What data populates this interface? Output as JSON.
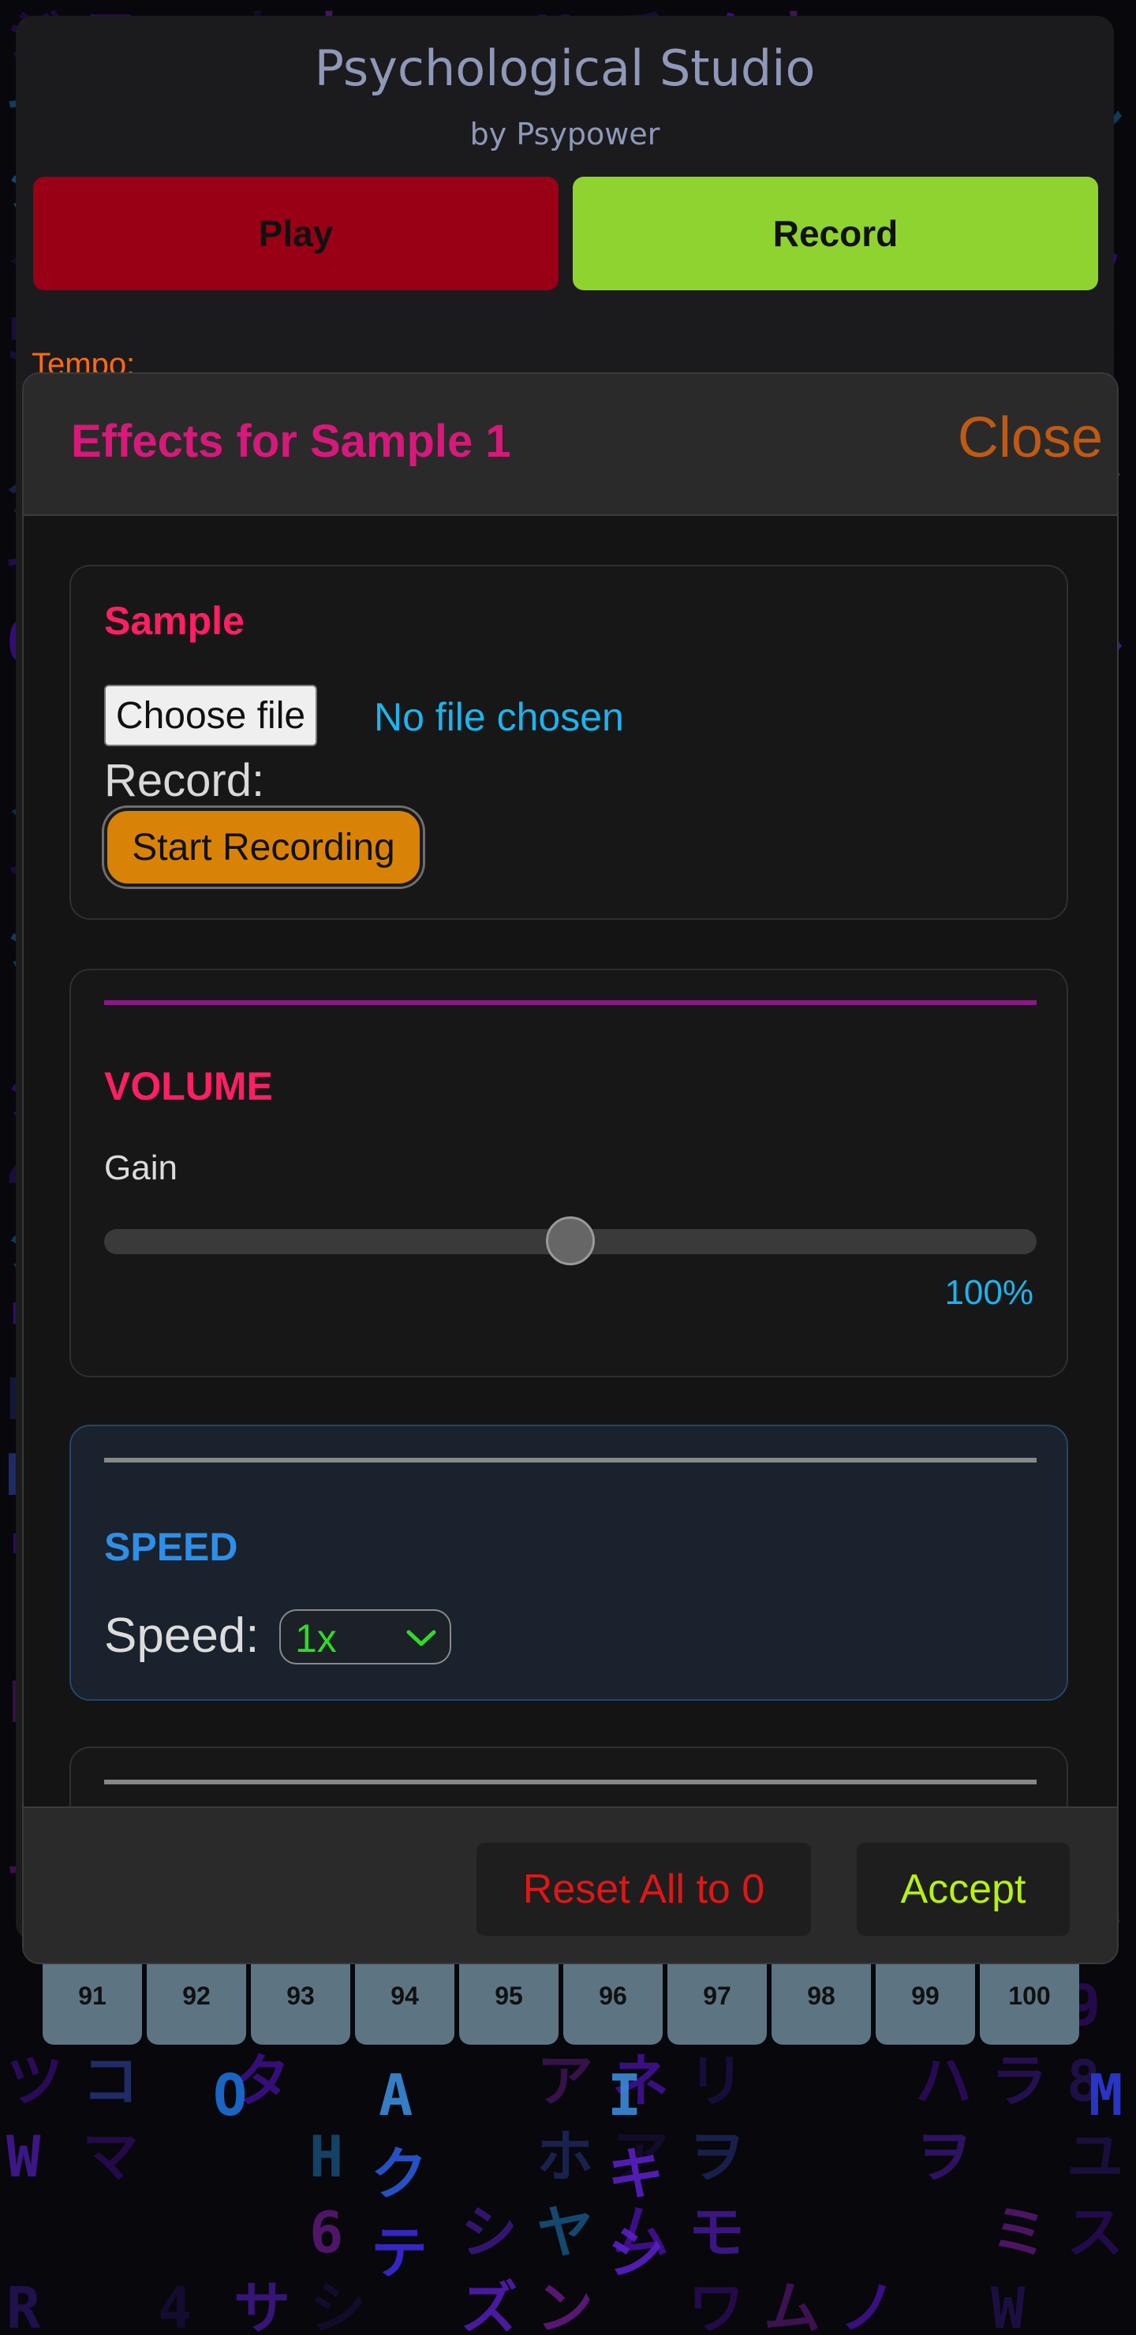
{
  "app": {
    "title": "Psychological Studio",
    "subtitle": "by Psypower",
    "play_label": "Play",
    "record_label": "Record",
    "tempo_label": "Tempo:"
  },
  "pads": [
    "91",
    "92",
    "93",
    "94",
    "95",
    "96",
    "97",
    "98",
    "99",
    "100"
  ],
  "modal": {
    "title": "Effects for Sample 1",
    "close_label": "Close",
    "sample": {
      "title": "Sample",
      "choose_file_label": "Choose file",
      "file_status": "No file chosen",
      "record_label": "Record:",
      "start_recording_label": "Start Recording"
    },
    "volume": {
      "title": "VOLUME",
      "gain_label": "Gain",
      "gain_value": "100%",
      "gain_level": 0.5
    },
    "speed": {
      "title": "SPEED",
      "speed_label": "Speed:",
      "speed_value": "1x"
    },
    "footer": {
      "reset_label": "Reset All to 0",
      "accept_label": "Accept"
    }
  },
  "background": {
    "style": "matrix-katakana-rain",
    "glyphs": "アイウエオカキクケコサシスセソタチツテトナニヌネノハヒフヘホマミムメモヤユヨラリルレロワヲンゲゼグジズダ0123456789ABCDEFGHIJKLMNOPQRSTUVWXYZ",
    "colors": [
      "#3a0d7a",
      "#4b12a8",
      "#5a1fc4",
      "#23104f",
      "#7a1f9e",
      "#2b1466",
      "#1a5a8a",
      "#2a3a8a"
    ],
    "highlight_glyphs": [
      "O",
      "A",
      "I",
      "M",
      "ク",
      "テ",
      "シ",
      "キ"
    ]
  },
  "colors": {
    "play": "#990016",
    "record": "#8fd330",
    "modal_title": "#d6197a",
    "close": "#c05a12",
    "sample_title": "#ff1f63",
    "volume_title": "#ff1f63",
    "speed_title": "#2e8fe8",
    "volume_divider": "#8a1a86",
    "speed_divider": "#888888",
    "reset": "#e01616",
    "accept": "#b7f20e"
  }
}
